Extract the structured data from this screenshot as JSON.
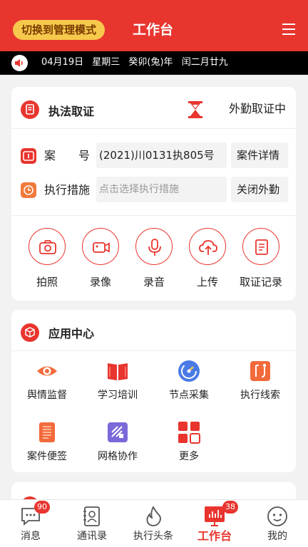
{
  "header": {
    "mode_button": "切换到管理模式",
    "title": "工作台",
    "menu_icon": "hamburger-menu-icon",
    "bg_color": "#e8352e"
  },
  "date_bar": {
    "date": "04月19日",
    "weekday": "星期三",
    "year": "癸卯(兔)年",
    "lunar": "闰二月廿九"
  },
  "evidence": {
    "title": "执法取证",
    "outwork_label": "外勤取证中",
    "case_label": "案　　号",
    "case_value": "(2021)川0131执805号",
    "case_detail_button": "案件详情",
    "measure_label": "执行措施",
    "measure_placeholder": "点击选择执行措施",
    "close_outwork_button": "关闭外勤",
    "actions": [
      {
        "label": "拍照",
        "icon": "camera-icon"
      },
      {
        "label": "录像",
        "icon": "video-camera-icon"
      },
      {
        "label": "录音",
        "icon": "microphone-icon"
      },
      {
        "label": "上传",
        "icon": "cloud-upload-icon"
      },
      {
        "label": "取证记录",
        "icon": "record-list-icon"
      }
    ]
  },
  "apps": {
    "title": "应用中心",
    "items": [
      {
        "label": "舆情监督",
        "icon": "eye-icon"
      },
      {
        "label": "学习培训",
        "icon": "book-icon"
      },
      {
        "label": "节点采集",
        "icon": "gauge-icon"
      },
      {
        "label": "执行线索",
        "icon": "clue-icon"
      },
      {
        "label": "案件便签",
        "icon": "notepad-icon"
      },
      {
        "label": "网格协作",
        "icon": "grid-collab-icon"
      },
      {
        "label": "更多",
        "icon": "more-grid-icon"
      }
    ]
  },
  "bottom_nav": {
    "items": [
      {
        "label": "消息",
        "icon": "message-icon",
        "badge": "90"
      },
      {
        "label": "通讯录",
        "icon": "contacts-icon",
        "badge": ""
      },
      {
        "label": "执行头条",
        "icon": "flame-icon",
        "badge": ""
      },
      {
        "label": "工作台",
        "icon": "workbench-icon",
        "badge": "38"
      },
      {
        "label": "我的",
        "icon": "profile-face-icon",
        "badge": ""
      }
    ],
    "active_index": 3
  }
}
